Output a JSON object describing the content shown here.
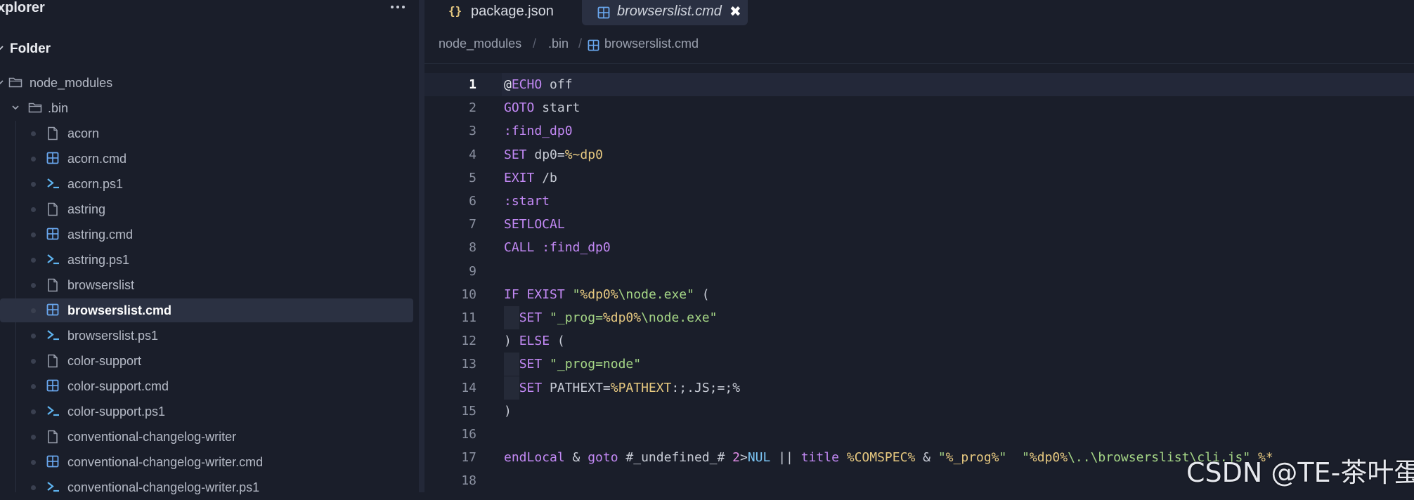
{
  "sidebar": {
    "title": "xplorer",
    "folder_label": "Folder",
    "items": [
      {
        "label": "node_modules",
        "icon": "folder-icon",
        "depth": 0,
        "expanded": true
      },
      {
        "label": ".bin",
        "icon": "folder-icon",
        "depth": 1,
        "expanded": true
      },
      {
        "label": "acorn",
        "icon": "file-icon",
        "depth": 2
      },
      {
        "label": "acorn.cmd",
        "icon": "windows-icon",
        "depth": 2
      },
      {
        "label": "acorn.ps1",
        "icon": "powershell-icon",
        "depth": 2
      },
      {
        "label": "astring",
        "icon": "file-icon",
        "depth": 2
      },
      {
        "label": "astring.cmd",
        "icon": "windows-icon",
        "depth": 2
      },
      {
        "label": "astring.ps1",
        "icon": "powershell-icon",
        "depth": 2
      },
      {
        "label": "browserslist",
        "icon": "file-icon",
        "depth": 2
      },
      {
        "label": "browserslist.cmd",
        "icon": "windows-icon",
        "depth": 2,
        "selected": true
      },
      {
        "label": "browserslist.ps1",
        "icon": "powershell-icon",
        "depth": 2
      },
      {
        "label": "color-support",
        "icon": "file-icon",
        "depth": 2
      },
      {
        "label": "color-support.cmd",
        "icon": "windows-icon",
        "depth": 2
      },
      {
        "label": "color-support.ps1",
        "icon": "powershell-icon",
        "depth": 2
      },
      {
        "label": "conventional-changelog-writer",
        "icon": "file-icon",
        "depth": 2
      },
      {
        "label": "conventional-changelog-writer.cmd",
        "icon": "windows-icon",
        "depth": 2
      },
      {
        "label": "conventional-changelog-writer.ps1",
        "icon": "powershell-icon",
        "depth": 2
      }
    ]
  },
  "tabs": [
    {
      "label": "package.json",
      "icon": "json-icon",
      "icon_text": "{}",
      "active": false
    },
    {
      "label": "browserslist.cmd",
      "icon": "windows-icon",
      "active": true,
      "close": "✖"
    }
  ],
  "breadcrumb": {
    "parts": [
      "node_modules",
      ".bin",
      "browserslist.cmd"
    ],
    "separator": "/"
  },
  "editor": {
    "current_line": 1,
    "lines": [
      {
        "n": "1",
        "text": "@ECHO off"
      },
      {
        "n": "2",
        "text": "GOTO start"
      },
      {
        "n": "3",
        "text": ":find_dp0"
      },
      {
        "n": "4",
        "text": "SET dp0=%~dp0"
      },
      {
        "n": "5",
        "text": "EXIT /b"
      },
      {
        "n": "6",
        "text": ":start"
      },
      {
        "n": "7",
        "text": "SETLOCAL"
      },
      {
        "n": "8",
        "text": "CALL :find_dp0"
      },
      {
        "n": "9",
        "text": ""
      },
      {
        "n": "10",
        "text": "IF EXIST \"%dp0%\\node.exe\" ("
      },
      {
        "n": "11",
        "text": "  SET \"_prog=%dp0%\\node.exe\""
      },
      {
        "n": "12",
        "text": ") ELSE ("
      },
      {
        "n": "13",
        "text": "  SET \"_prog=node\""
      },
      {
        "n": "14",
        "text": "  SET PATHEXT=%PATHEXT:;.JS;=;%"
      },
      {
        "n": "15",
        "text": ")"
      },
      {
        "n": "16",
        "text": ""
      },
      {
        "n": "17",
        "text": "endLocal & goto #_undefined_# 2>NUL || title %COMSPEC% & \"%_prog%\"  \"%dp0%\\..\\browserslist\\cli.js\" %*"
      },
      {
        "n": "18",
        "text": ""
      }
    ]
  },
  "watermark": "CSDN @TE-茶叶蛋",
  "colors": {
    "background": "#1a1e2a",
    "keyword": "#c389f5",
    "variable": "#e7c980",
    "string": "#a5d686",
    "selection": "#2b3142"
  }
}
